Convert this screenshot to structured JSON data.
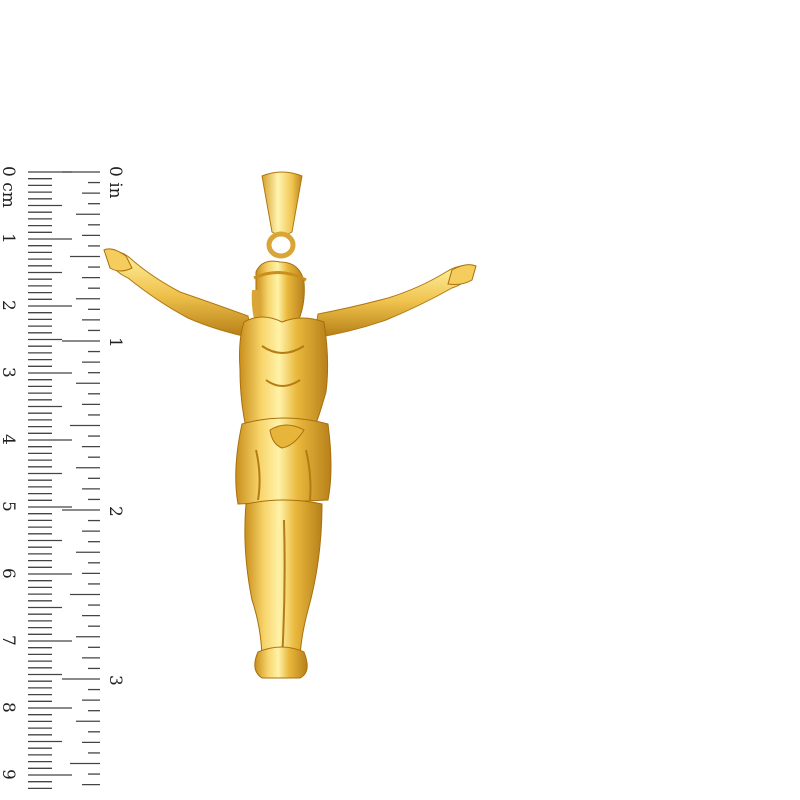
{
  "image": {
    "subject": "gold-crucifix-pendant",
    "background": "#ffffff",
    "metal_colors": {
      "highlight": "#fff2a8",
      "light": "#f7d46a",
      "mid": "#e9b83c",
      "shadow": "#c98f1c",
      "deep": "#a8700e"
    }
  },
  "ruler": {
    "cm_unit": "cm",
    "in_unit": "in",
    "cm_labels": [
      "0",
      "1",
      "2",
      "3",
      "4",
      "5",
      "6",
      "7",
      "8",
      "9"
    ],
    "in_labels": [
      "0",
      "1",
      "2",
      "3"
    ],
    "tick_color": "#444444"
  }
}
